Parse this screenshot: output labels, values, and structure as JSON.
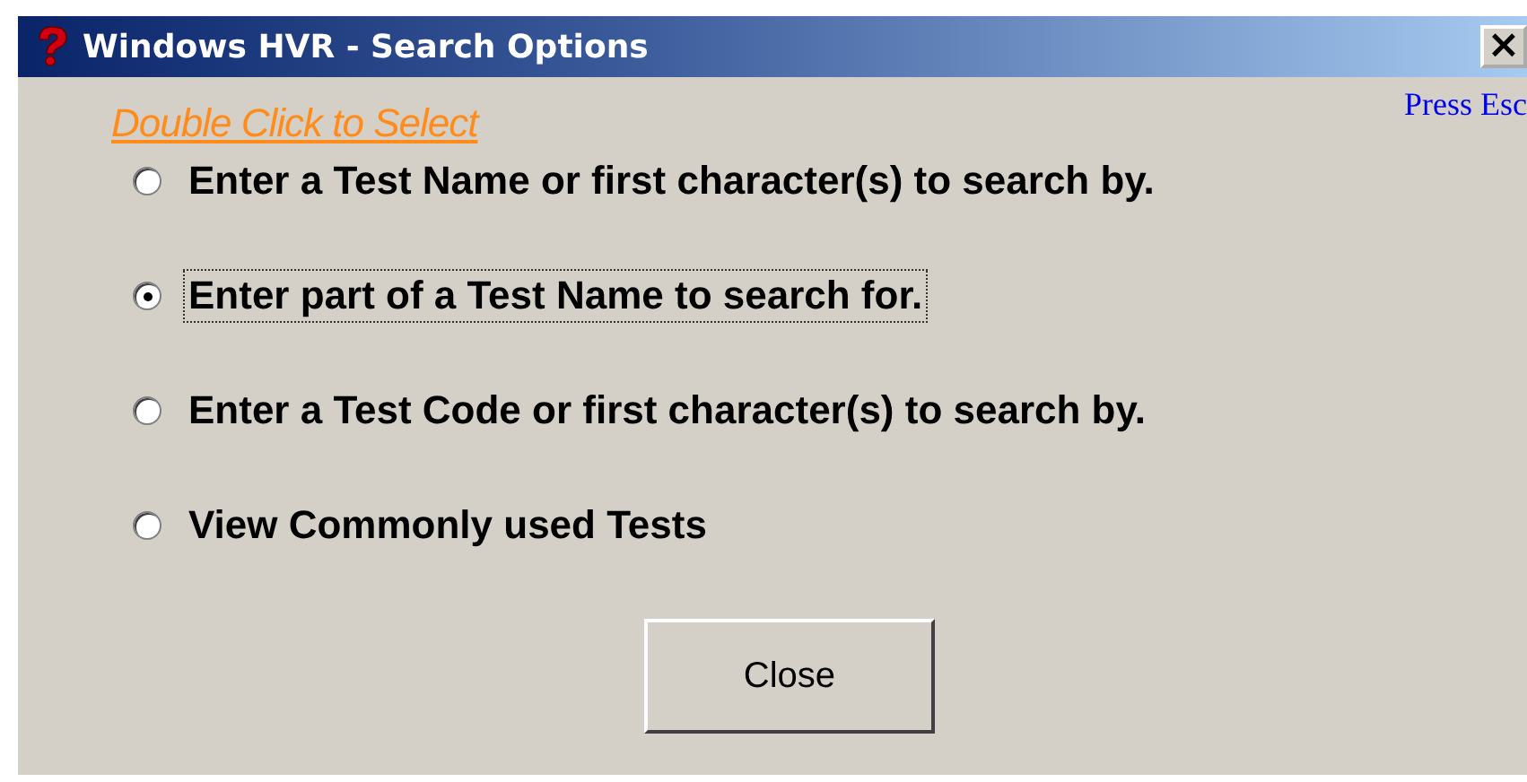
{
  "window": {
    "title": "Windows HVR - Search Options",
    "close_glyph": "×"
  },
  "hint": "Double Click to Select",
  "esc_hint": "Press Esc",
  "options": [
    {
      "label": "Enter a Test Name or first character(s) to search by.",
      "selected": false
    },
    {
      "label": "Enter part of a Test Name to search for.",
      "selected": true
    },
    {
      "label": "Enter a Test Code or first character(s) to search by.",
      "selected": false
    },
    {
      "label": "View Commonly used Tests",
      "selected": false
    }
  ],
  "buttons": [
    "Close"
  ]
}
